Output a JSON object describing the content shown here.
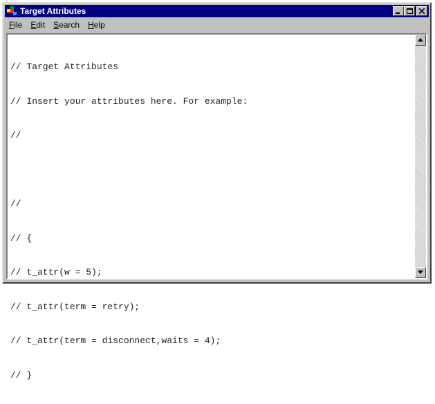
{
  "window": {
    "title": "Target Attributes",
    "icon": "app-icon",
    "controls": {
      "minimize": "minimize-icon",
      "maximize": "maximize-icon",
      "close": "close-icon"
    }
  },
  "menu": [
    {
      "label": "File",
      "underline": "F"
    },
    {
      "label": "Edit",
      "underline": "E"
    },
    {
      "label": "Search",
      "underline": "S"
    },
    {
      "label": "Help",
      "underline": "H"
    }
  ],
  "editor": {
    "lines": [
      "// Target Attributes",
      "// Insert your attributes here. For example:",
      "//",
      "",
      "//",
      "// {",
      "// t_attr(w = 5);",
      "// t_attr(term = retry);",
      "// t_attr(term = disconnect,waits = 4);",
      "// }"
    ]
  },
  "colors": {
    "titlebar": "#000080",
    "chrome": "#c0c0c0",
    "editor_bg": "#ffffff"
  }
}
